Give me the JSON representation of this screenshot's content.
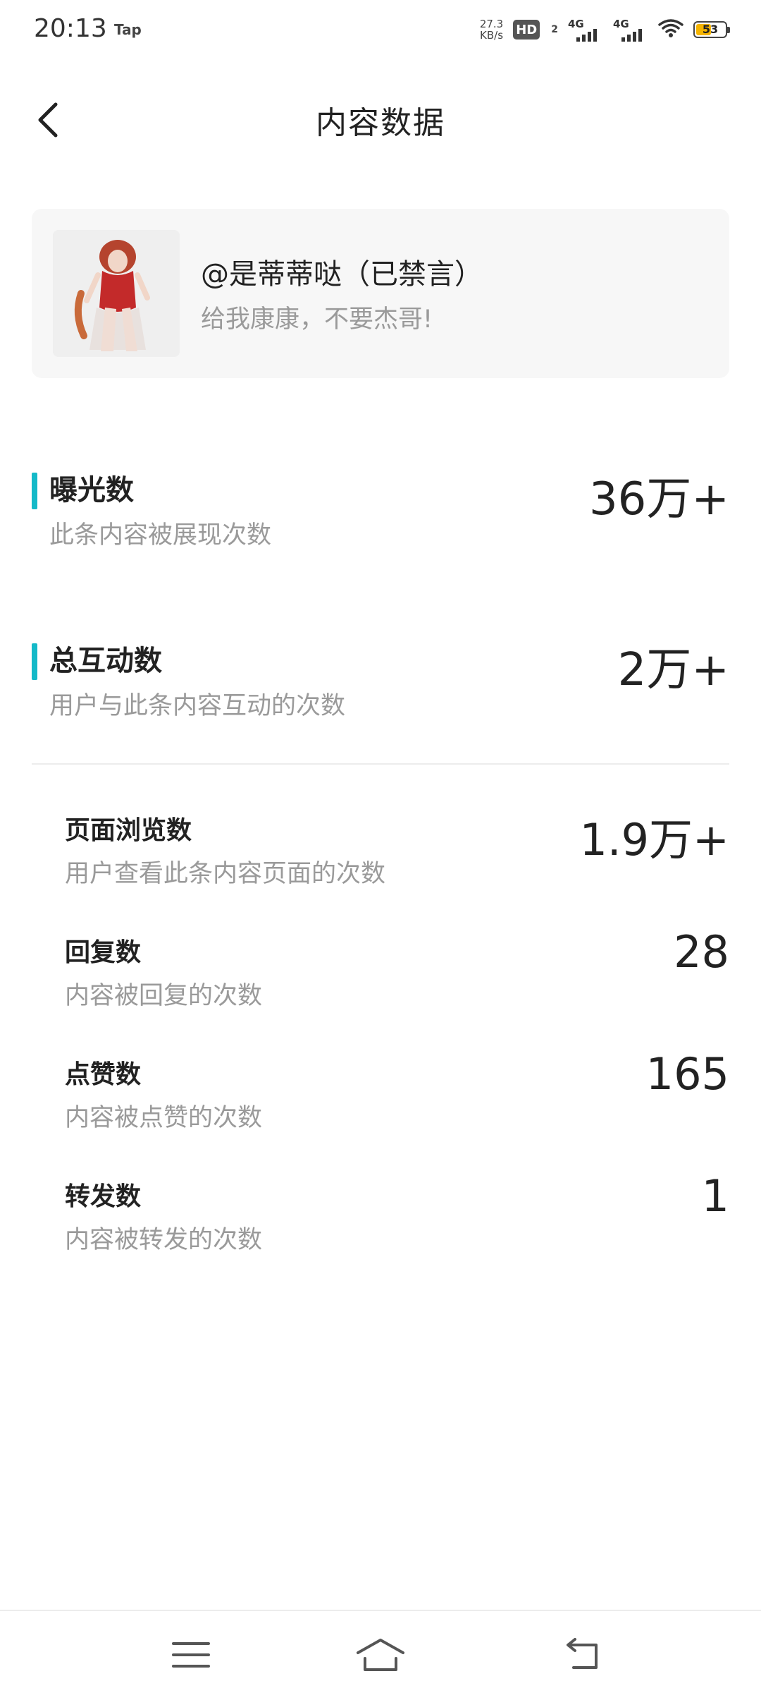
{
  "status_bar": {
    "time": "20:13",
    "app": "Tap",
    "net_speed": "27.3",
    "net_unit": "KB/s",
    "hd_label": "HD",
    "hd_sub": "2",
    "sig1_label": "4G",
    "sig2_label": "4G",
    "battery_level": "53",
    "battery_color": "#f5b400"
  },
  "header": {
    "title": "内容数据"
  },
  "post": {
    "author": "@是蒂蒂哒（已禁言）",
    "description": "给我康康，不要杰哥!"
  },
  "metrics": [
    {
      "label": "曝光数",
      "desc": "此条内容被展现次数",
      "value": "36万+"
    },
    {
      "label": "总互动数",
      "desc": "用户与此条内容互动的次数",
      "value": "2万+"
    }
  ],
  "sub_metrics": [
    {
      "label": "页面浏览数",
      "desc": "用户查看此条内容页面的次数",
      "value": "1.9万+"
    },
    {
      "label": "回复数",
      "desc": "内容被回复的次数",
      "value": "28"
    },
    {
      "label": "点赞数",
      "desc": "内容被点赞的次数",
      "value": "165"
    },
    {
      "label": "转发数",
      "desc": "内容被转发的次数",
      "value": "1"
    }
  ],
  "accent_color": "#14b9c8"
}
